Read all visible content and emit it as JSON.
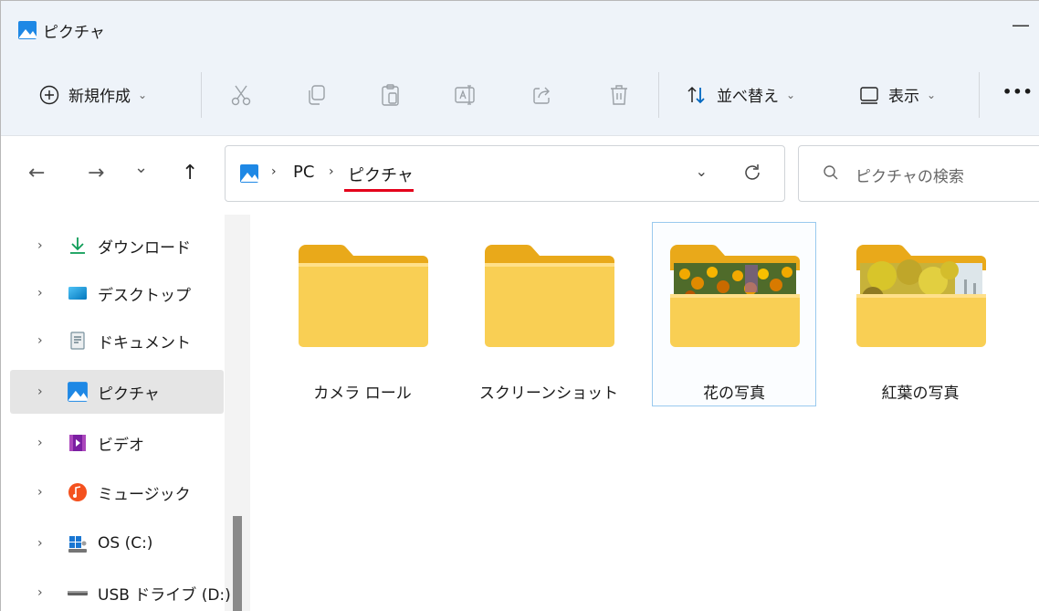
{
  "window": {
    "title": "ピクチャ",
    "minimize_glyph": "—"
  },
  "toolbar": {
    "new_label": "新規作成",
    "sort_label": "並べ替え",
    "view_label": "表示",
    "more_glyph": "•••",
    "chevron": "⌄",
    "icons": [
      "cut-icon",
      "copy-icon",
      "paste-icon",
      "rename-icon",
      "share-icon",
      "delete-icon"
    ]
  },
  "nav": {
    "back": "←",
    "forward": "→",
    "recent": "⌄",
    "up": "↑",
    "breadcrumb": [
      "PC",
      "ピクチャ"
    ],
    "crumb_sep": "›",
    "search_placeholder": "ピクチャの検索"
  },
  "sidebar": {
    "items": [
      {
        "label": "ダウンロード",
        "icon": "download-icon"
      },
      {
        "label": "デスクトップ",
        "icon": "desktop-icon"
      },
      {
        "label": "ドキュメント",
        "icon": "documents-icon"
      },
      {
        "label": "ピクチャ",
        "icon": "pictures-icon",
        "selected": true
      },
      {
        "label": "ビデオ",
        "icon": "videos-icon"
      },
      {
        "label": "ミュージック",
        "icon": "music-icon"
      },
      {
        "label": "OS (C:)",
        "icon": "drive-icon"
      },
      {
        "label": "USB ドライブ (D:)",
        "icon": "usb-drive-icon"
      }
    ],
    "expand_glyph": "›"
  },
  "folders": [
    {
      "name": "カメラ ロール",
      "preview": false
    },
    {
      "name": "スクリーンショット",
      "preview": false
    },
    {
      "name": "花の写真",
      "preview": "flowers",
      "selected": true
    },
    {
      "name": "紅葉の写真",
      "preview": "autumn"
    }
  ],
  "colors": {
    "accent": "#0067c0",
    "highlight": "#e4001b",
    "folder": "#f7c948"
  }
}
